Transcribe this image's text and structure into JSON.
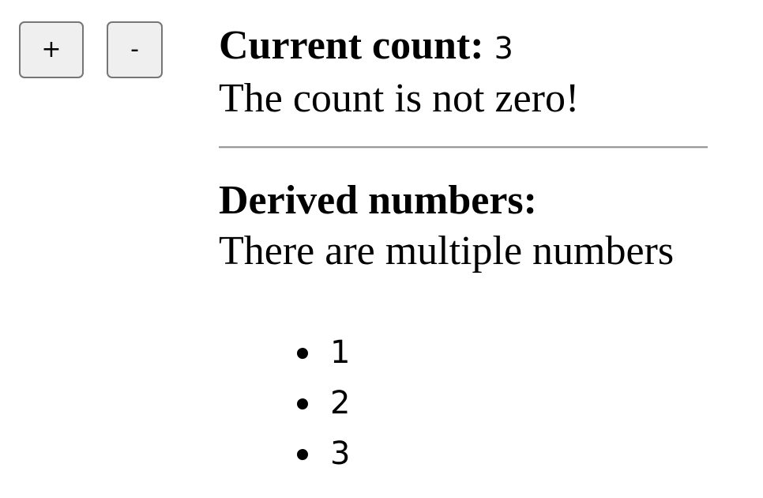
{
  "controls": {
    "increment_label": "+",
    "decrement_label": "-"
  },
  "counter": {
    "label": "Current count:",
    "value": "3",
    "status_text": "The count is not zero!"
  },
  "derived": {
    "heading": "Derived numbers:",
    "description": "There are multiple numbers",
    "items": [
      "1",
      "2",
      "3"
    ]
  }
}
